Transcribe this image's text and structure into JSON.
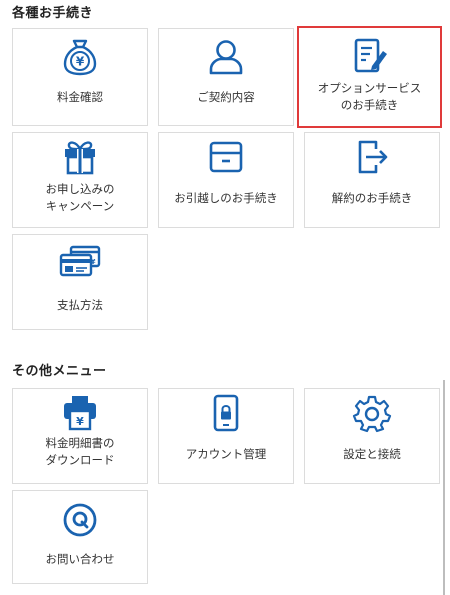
{
  "sections": [
    {
      "title": "各種お手続き",
      "items": [
        {
          "label": "料金確認",
          "icon": "yen-bag-icon"
        },
        {
          "label": "ご契約内容",
          "icon": "person-icon"
        },
        {
          "label": "オプションサービス\nのお手続き",
          "icon": "edit-document-icon"
        },
        {
          "label": "お申し込みの\nキャンペーン",
          "icon": "gift-icon"
        },
        {
          "label": "お引越しのお手続き",
          "icon": "box-icon"
        },
        {
          "label": "解約のお手続き",
          "icon": "exit-icon"
        },
        {
          "label": "支払方法",
          "icon": "credit-card-icon"
        }
      ]
    },
    {
      "title": "その他メニュー",
      "items": [
        {
          "label": "料金明細書の\nダウンロード",
          "icon": "printer-yen-icon"
        },
        {
          "label": "アカウント管理",
          "icon": "smartphone-lock-icon"
        },
        {
          "label": "設定と接続",
          "icon": "gear-icon"
        },
        {
          "label": "お問い合わせ",
          "icon": "question-circle-icon"
        }
      ]
    }
  ],
  "colors": {
    "icon_blue": "#1a63b0",
    "highlight_border": "#e03a3a",
    "tile_border": "#dcdcdc"
  }
}
